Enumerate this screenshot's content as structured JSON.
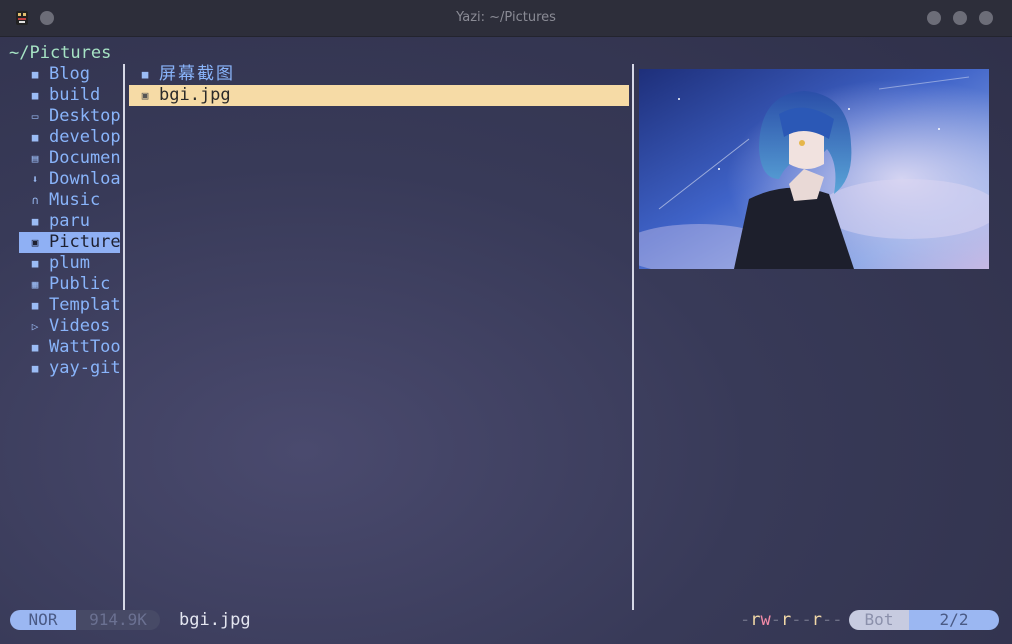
{
  "window": {
    "title": "Yazi: ~/Pictures"
  },
  "cwd": "~/Pictures",
  "parent_entries": [
    {
      "label": "Blog",
      "icon": "folder-icon"
    },
    {
      "label": "build",
      "icon": "folder-icon"
    },
    {
      "label": "Desktop",
      "icon": "desktop-icon"
    },
    {
      "label": "develop",
      "icon": "folder-icon"
    },
    {
      "label": "Documen",
      "icon": "document-icon"
    },
    {
      "label": "Downloa",
      "icon": "download-icon"
    },
    {
      "label": "Music",
      "icon": "headphones-icon"
    },
    {
      "label": "paru",
      "icon": "folder-icon"
    },
    {
      "label": "Picture",
      "icon": "image-folder-icon",
      "highlighted": true
    },
    {
      "label": "plum",
      "icon": "folder-icon"
    },
    {
      "label": "Public",
      "icon": "public-icon"
    },
    {
      "label": "Templat",
      "icon": "folder-icon"
    },
    {
      "label": "Videos",
      "icon": "video-icon"
    },
    {
      "label": "WattToo",
      "icon": "folder-icon"
    },
    {
      "label": "yay-git",
      "icon": "folder-icon"
    }
  ],
  "current_entries": [
    {
      "label": "屏幕截图",
      "icon": "folder-icon"
    },
    {
      "label": "bgi.jpg",
      "icon": "image-file-icon",
      "selected": true
    }
  ],
  "preview": {
    "icon": "image-preview"
  },
  "status": {
    "mode": "NOR",
    "size": "914.9K",
    "filename": "bgi.jpg",
    "permissions": "-rw-r--r--",
    "position": "Bot",
    "count": "2/2"
  },
  "colors": {
    "accent": "#89b4fa",
    "selection": "#f6dba6",
    "cwd": "#a6e3c4"
  }
}
